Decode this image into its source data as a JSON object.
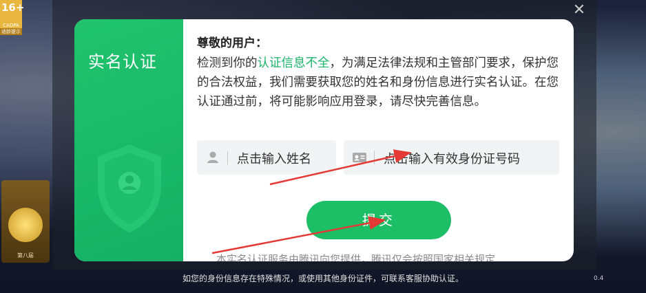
{
  "overlay": {
    "age_rating": {
      "number": "16+",
      "org": "CADPA",
      "tip": "适龄提示"
    },
    "badge_label": "第八届",
    "close_icon": "close-icon",
    "version_fragment": "0.4",
    "bottom_note": "如您的身份信息存在特殊情况，或使用其他身份证件，可联系客服协助认证。"
  },
  "dialog": {
    "side_title": "实名认证",
    "side_icon": "shield-user-icon",
    "greeting": "尊敬的用户：",
    "message_before": "检测到你的",
    "message_highlight": "认证信息不全",
    "message_after": "，为满足法律法规和主管部门要求，保护您的合法权益，我们需要获取您的姓名和身份信息进行实名认证。在您认证通过前，将可能影响应用登录，请尽快完善信息。",
    "name_field": {
      "placeholder": "点击输入姓名",
      "icon": "user-icon"
    },
    "id_field": {
      "placeholder": "点击输入有效身份证号码",
      "icon": "id-card-icon"
    },
    "submit_label": "提交",
    "footer_text": "本实名认证服务由腾讯向您提供，腾讯仅会按照国家相关规定"
  },
  "colors": {
    "accent_green": "#1dbf66",
    "highlight_text": "#1bb36a",
    "arrow_red": "#e53935"
  }
}
